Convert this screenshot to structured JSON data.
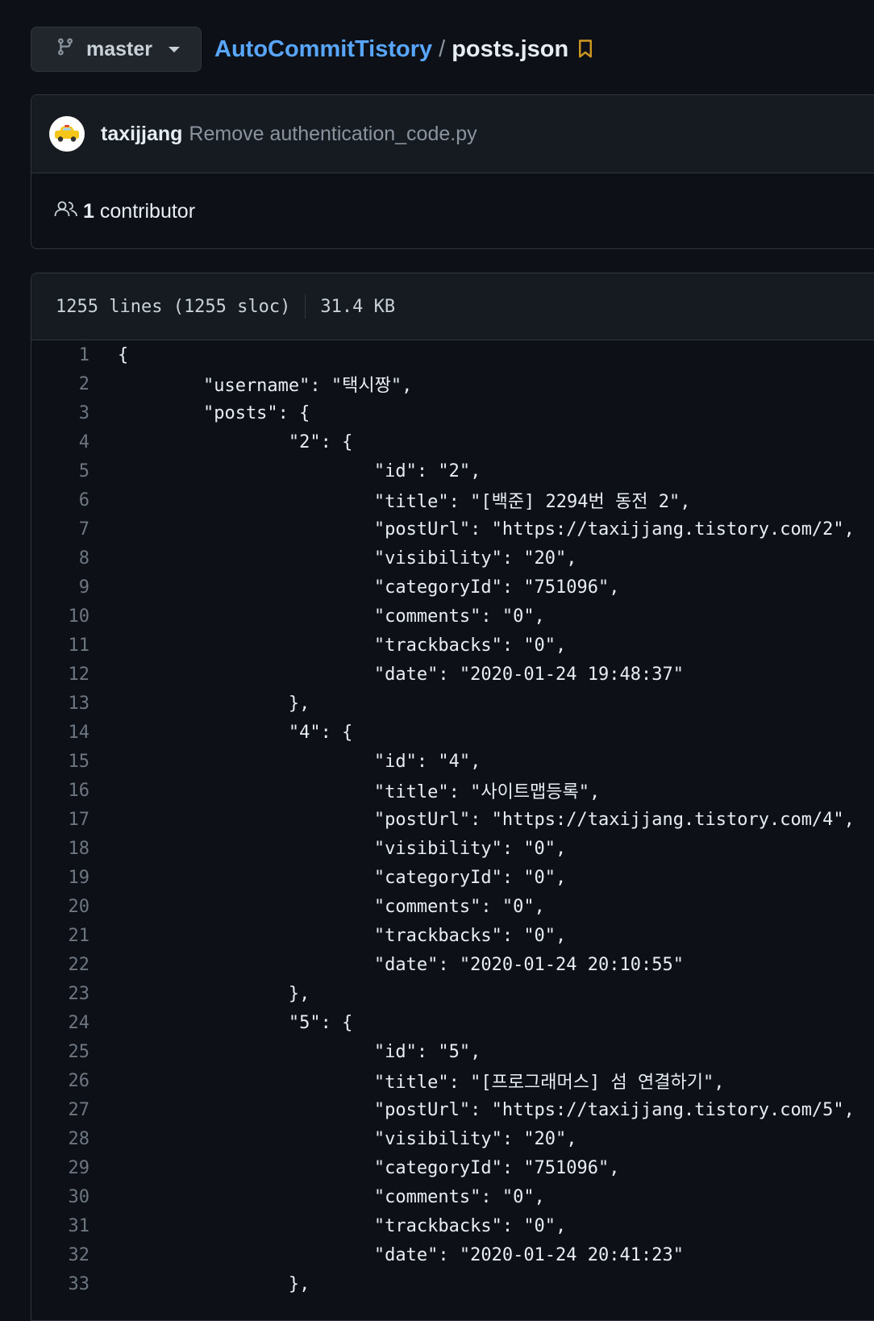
{
  "branch": {
    "name": "master"
  },
  "breadcrumb": {
    "repo": "AutoCommitTistory",
    "separator": "/",
    "file": "posts.json"
  },
  "commit": {
    "author": "taxijjang",
    "message": "Remove authentication_code.py"
  },
  "contributors": {
    "count": "1",
    "label": "contributor"
  },
  "file_info": {
    "lines": "1255 lines (1255 sloc)",
    "size": "31.4 KB"
  },
  "code": [
    {
      "n": "1",
      "t": "{"
    },
    {
      "n": "2",
      "t": "        \"username\": \"택시짱\","
    },
    {
      "n": "3",
      "t": "        \"posts\": {"
    },
    {
      "n": "4",
      "t": "                \"2\": {"
    },
    {
      "n": "5",
      "t": "                        \"id\": \"2\","
    },
    {
      "n": "6",
      "t": "                        \"title\": \"[백준] 2294번 동전 2\","
    },
    {
      "n": "7",
      "t": "                        \"postUrl\": \"https://taxijjang.tistory.com/2\","
    },
    {
      "n": "8",
      "t": "                        \"visibility\": \"20\","
    },
    {
      "n": "9",
      "t": "                        \"categoryId\": \"751096\","
    },
    {
      "n": "10",
      "t": "                        \"comments\": \"0\","
    },
    {
      "n": "11",
      "t": "                        \"trackbacks\": \"0\","
    },
    {
      "n": "12",
      "t": "                        \"date\": \"2020-01-24 19:48:37\""
    },
    {
      "n": "13",
      "t": "                },"
    },
    {
      "n": "14",
      "t": "                \"4\": {"
    },
    {
      "n": "15",
      "t": "                        \"id\": \"4\","
    },
    {
      "n": "16",
      "t": "                        \"title\": \"사이트맵등록\","
    },
    {
      "n": "17",
      "t": "                        \"postUrl\": \"https://taxijjang.tistory.com/4\","
    },
    {
      "n": "18",
      "t": "                        \"visibility\": \"0\","
    },
    {
      "n": "19",
      "t": "                        \"categoryId\": \"0\","
    },
    {
      "n": "20",
      "t": "                        \"comments\": \"0\","
    },
    {
      "n": "21",
      "t": "                        \"trackbacks\": \"0\","
    },
    {
      "n": "22",
      "t": "                        \"date\": \"2020-01-24 20:10:55\""
    },
    {
      "n": "23",
      "t": "                },"
    },
    {
      "n": "24",
      "t": "                \"5\": {"
    },
    {
      "n": "25",
      "t": "                        \"id\": \"5\","
    },
    {
      "n": "26",
      "t": "                        \"title\": \"[프로그래머스] 섬 연결하기\","
    },
    {
      "n": "27",
      "t": "                        \"postUrl\": \"https://taxijjang.tistory.com/5\","
    },
    {
      "n": "28",
      "t": "                        \"visibility\": \"20\","
    },
    {
      "n": "29",
      "t": "                        \"categoryId\": \"751096\","
    },
    {
      "n": "30",
      "t": "                        \"comments\": \"0\","
    },
    {
      "n": "31",
      "t": "                        \"trackbacks\": \"0\","
    },
    {
      "n": "32",
      "t": "                        \"date\": \"2020-01-24 20:41:23\""
    },
    {
      "n": "33",
      "t": "                },"
    }
  ]
}
